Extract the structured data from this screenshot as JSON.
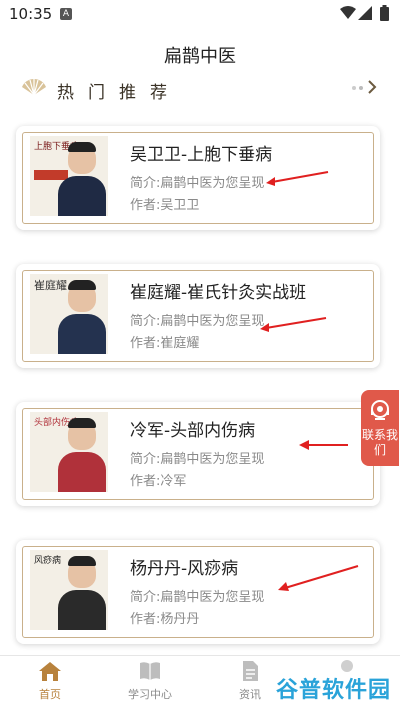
{
  "status_bar": {
    "time": "10:35",
    "notification_badge": "A"
  },
  "header": {
    "title": "扁鹊中医"
  },
  "section": {
    "title": "热门推荐"
  },
  "courses": [
    {
      "title": "吴卫卫-上胞下垂病",
      "intro": "简介:扁鹊中医为您呈现",
      "author": "作者:吴卫卫",
      "thumb_text": "上胞下垂病",
      "thumb_color": "#1f2a44"
    },
    {
      "title": "崔庭耀-崔氏针灸实战班",
      "intro": "简介:扁鹊中医为您呈现",
      "author": "作者:崔庭耀",
      "thumb_text": "崔庭耀",
      "thumb_color": "#24324f"
    },
    {
      "title": "冷军-头部内伤病",
      "intro": "简介:扁鹊中医为您呈现",
      "author": "作者:冷军",
      "thumb_text": "头部内伤病",
      "thumb_color": "#b0313a"
    },
    {
      "title": "杨丹丹-风痧病",
      "intro": "简介:扁鹊中医为您呈现",
      "author": "作者:杨丹丹",
      "thumb_text": "风痧病",
      "thumb_color": "#2a2a2a"
    }
  ],
  "contact": {
    "label": "联系我们"
  },
  "tabbar": {
    "home": "首页",
    "study": "学习中心",
    "news": "资讯"
  },
  "watermark": {
    "text": "谷普软件园"
  },
  "colors": {
    "accent": "#b8823d",
    "card_border": "#c9b08b",
    "arrow": "#e02020",
    "contact_bg": "#e0594a"
  }
}
